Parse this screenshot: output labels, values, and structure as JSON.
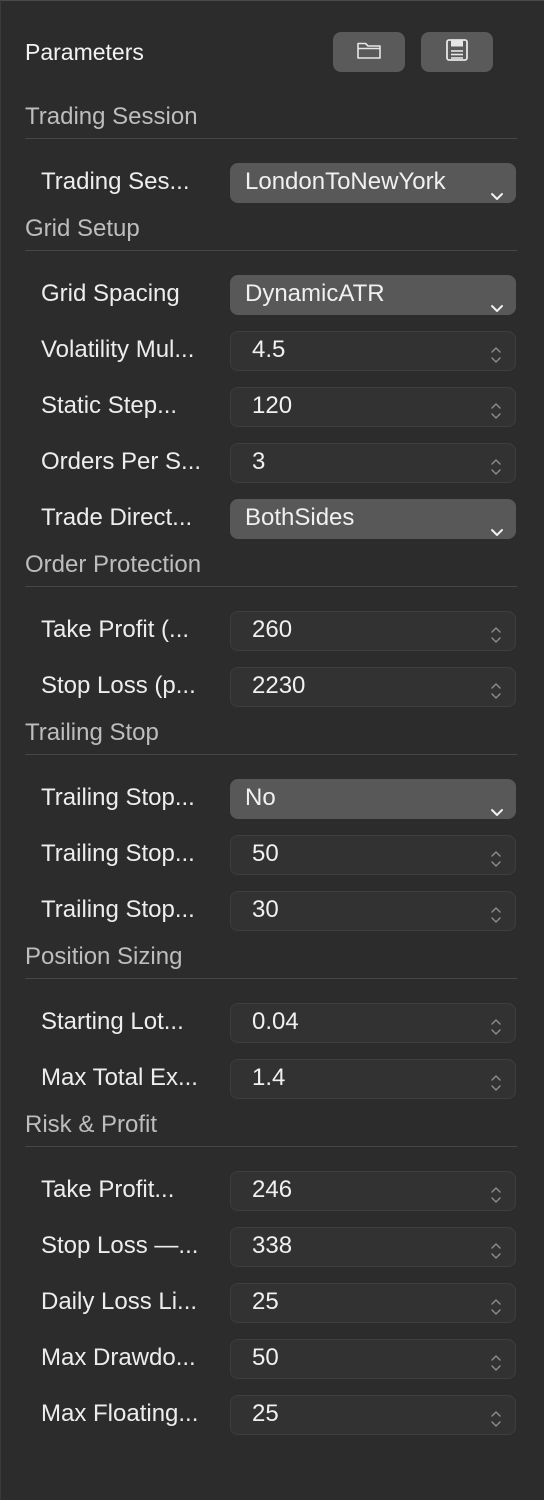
{
  "panel": {
    "title": "Parameters",
    "buttons": [
      {
        "name": "open-folder",
        "icon": "folder-icon"
      },
      {
        "name": "save",
        "icon": "floppy-disk-icon"
      }
    ]
  },
  "sections": [
    {
      "label": "Trading Session",
      "rows": [
        {
          "label": "Trading Ses...",
          "type": "select",
          "value": "LondonToNewYork"
        }
      ]
    },
    {
      "label": "Grid Setup",
      "rows": [
        {
          "label": "Grid Spacing",
          "type": "select",
          "value": "DynamicATR"
        },
        {
          "label": "Volatility Mul...",
          "type": "number",
          "value": "4.5"
        },
        {
          "label": "Static Step...",
          "type": "number",
          "value": "120"
        },
        {
          "label": "Orders Per S...",
          "type": "number",
          "value": "3"
        },
        {
          "label": "Trade Direct...",
          "type": "select",
          "value": "BothSides"
        }
      ]
    },
    {
      "label": "Order Protection",
      "rows": [
        {
          "label": "Take Profit (...",
          "type": "number",
          "value": "260"
        },
        {
          "label": "Stop Loss (p...",
          "type": "number",
          "value": "2230"
        }
      ]
    },
    {
      "label": "Trailing Stop",
      "rows": [
        {
          "label": "Trailing Stop...",
          "type": "select",
          "value": "No"
        },
        {
          "label": "Trailing Stop...",
          "type": "number",
          "value": "50"
        },
        {
          "label": "Trailing Stop...",
          "type": "number",
          "value": "30"
        }
      ]
    },
    {
      "label": "Position Sizing",
      "rows": [
        {
          "label": "Starting Lot...",
          "type": "number",
          "value": "0.04"
        },
        {
          "label": "Max Total Ex...",
          "type": "number",
          "value": "1.4"
        }
      ]
    },
    {
      "label": "Risk & Profit",
      "rows": [
        {
          "label": "Take Profit...",
          "type": "number",
          "value": "246"
        },
        {
          "label": "Stop Loss —...",
          "type": "number",
          "value": "338"
        },
        {
          "label": "Daily Loss Li...",
          "type": "number",
          "value": "25"
        },
        {
          "label": "Max Drawdo...",
          "type": "number",
          "value": "50"
        },
        {
          "label": "Max Floating...",
          "type": "number",
          "value": "25"
        }
      ]
    }
  ]
}
